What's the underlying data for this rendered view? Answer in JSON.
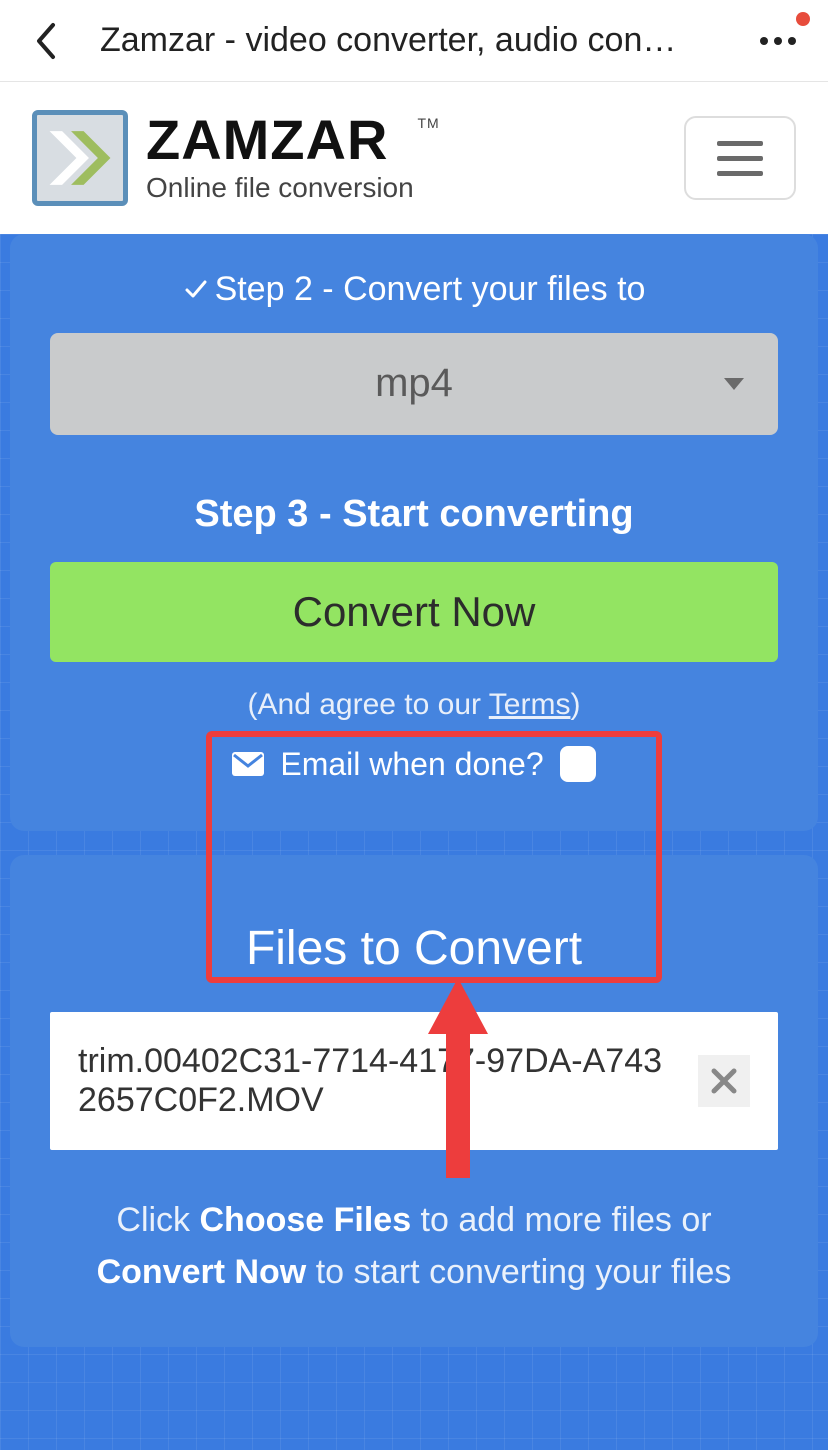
{
  "browser": {
    "title": "Zamzar - video converter, audio con…"
  },
  "header": {
    "brand": "ZAMZAR",
    "tm": "TM",
    "tagline": "Online file conversion"
  },
  "step2": {
    "label": "Step 2 - Convert your files to",
    "selected": "mp4"
  },
  "step3": {
    "label": "Step 3 - Start converting",
    "button": "Convert Now",
    "terms_prefix": "(And agree to our ",
    "terms_link": "Terms",
    "terms_suffix": ")",
    "email_label": "Email when done?"
  },
  "files": {
    "title": "Files to Convert",
    "items": [
      {
        "name": "trim.00402C31-7714-4177-97DA-A7432657C0F2.MOV"
      }
    ],
    "hint_before": "Click ",
    "hint_choose": "Choose Files",
    "hint_mid": " to add more files or ",
    "hint_convert": "Convert Now",
    "hint_after": " to start converting your files"
  }
}
